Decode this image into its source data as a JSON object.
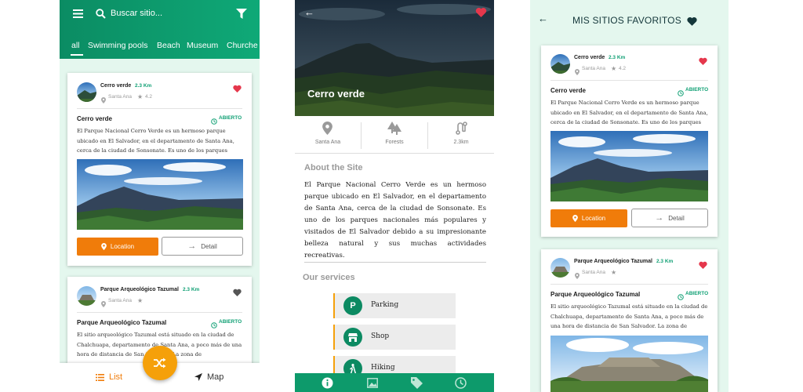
{
  "list_screen": {
    "search": {
      "placeholder": "Buscar sitio..."
    },
    "tabs": [
      "all",
      "Swimming pools",
      "Beach",
      "Museum",
      "Churche"
    ],
    "cards": [
      {
        "name": "Cerro verde",
        "distance": "2.3 Km",
        "location": "Santa Ana",
        "rating": "4.2",
        "title": "Cerro verde",
        "status": "ABIERTO",
        "description": "El Parque Nacional Cerro Verde es un hermoso parque ubicado en El Salvador, en el departamento de Santa Ana, cerca de la ciudad de Sonsonate. Es uno de los parques",
        "favorite": true
      },
      {
        "name": "Parque Arqueológico Tazumal",
        "distance": "2.3 Km",
        "location": "Santa Ana",
        "rating": "",
        "title": "Parque Arqueológico Tazumal",
        "status": "ABIERTO",
        "description": "El sitio arqueológico Tazumal está situado en la ciudad de Chalchuapa, departamento de Santa Ana, a poco más de una hora de distancia de San Salvador. La zona de",
        "favorite": false
      }
    ],
    "location_button": "Location",
    "detail_button": "Detail",
    "bottom_nav": {
      "list": "List",
      "map": "Map"
    }
  },
  "detail_screen": {
    "title": "Cerro verde",
    "info": [
      {
        "label": "Santa Ana",
        "icon": "location-pin-icon"
      },
      {
        "label": "Forests",
        "icon": "trees-icon"
      },
      {
        "label": "2.3km",
        "icon": "route-icon"
      }
    ],
    "about_heading": "About the Site",
    "about_text": "El Parque Nacional Cerro Verde es un hermoso parque ubicado en El Salvador, en el departamento de Santa Ana, cerca de la ciudad de Sonsonate. Es uno de los parques nacionales más populares y visitados de El Salvador debido a su impresionante belleza natural y sus muchas actividades recreativas.",
    "services_heading": "Our services",
    "services": [
      {
        "label": "Parking",
        "icon": "P"
      },
      {
        "label": "Shop",
        "icon": "shop-icon"
      },
      {
        "label": "Hiking",
        "icon": "hiking-icon"
      }
    ]
  },
  "favorites_screen": {
    "title": "MIS SITIOS FAVORITOS",
    "cards": [
      {
        "name": "Cerro verde",
        "distance": "2.3 Km",
        "location": "Santa Ana",
        "rating": "4.2",
        "title": "Cerro verde",
        "status": "ABIERTO",
        "description": "El Parque Nacional Cerro Verde es un hermoso parque ubicado en El Salvador, en el departamento de Santa Ana, cerca de la ciudad de Sonsonate. Es uno de los parques"
      },
      {
        "name": "Parque Arqueológico Tazumal",
        "distance": "2.3 Km",
        "location": "Santa Ana",
        "rating": "",
        "title": "Parque Arqueológico Tazumal",
        "status": "ABIERTO",
        "description": "El sitio arqueológico Tazumal está situado en la ciudad de Chalchuapa, departamento de Santa Ana, a poco más de una hora de distancia de San Salvador. La zona de"
      }
    ],
    "location_button": "Location",
    "detail_button": "Detail"
  },
  "colors": {
    "primary_green": "#0d9a6b",
    "accent_orange": "#f07c0a",
    "fab_orange": "#f5a00a",
    "favorite_red": "#e5374c",
    "background_mint": "#e4f7ee"
  }
}
